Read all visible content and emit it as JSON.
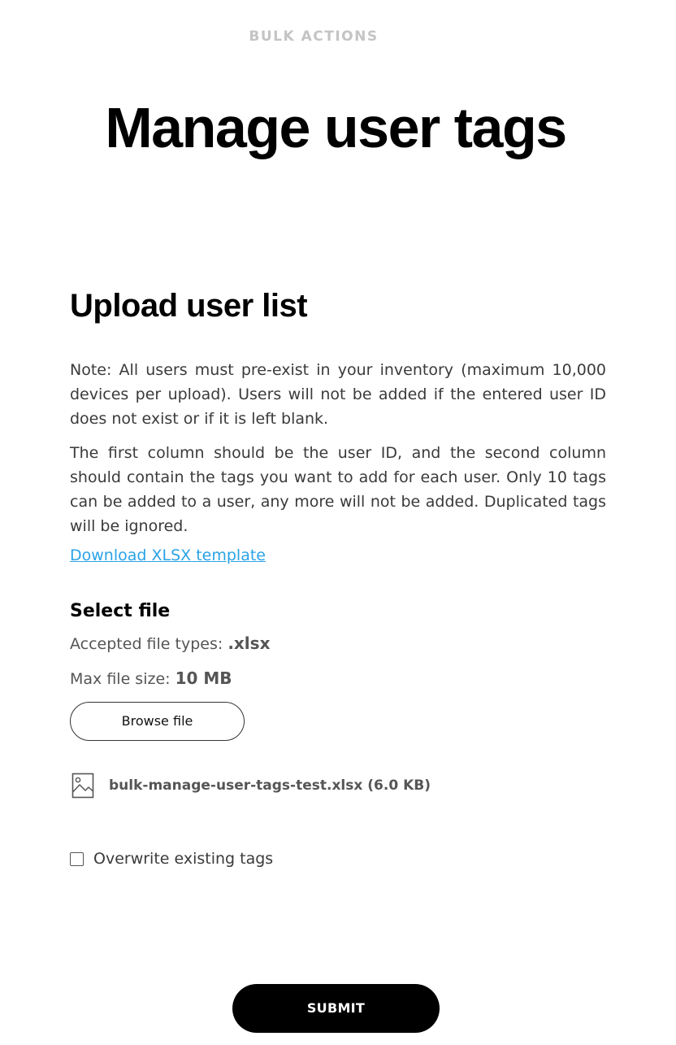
{
  "header": {
    "eyebrow": "BULK ACTIONS",
    "title": "Manage user tags"
  },
  "upload": {
    "section_title": "Upload user list",
    "note_1": "Note: All users must pre-exist in your inventory (maximum 10,000 devices per upload). Users will not be added if the entered user ID does not exist or if it is left blank.",
    "note_2": "The first column should be the user ID, and the second column should contain the tags you want to add for each user. Only 10 tags can be added to a user, any more will not be added. Duplicated tags will be ignored.",
    "template_link": "Download XLSX template"
  },
  "select_file": {
    "title": "Select file",
    "types_label": "Accepted file types: ",
    "types_value": ".xlsx",
    "size_label": "Max file size: ",
    "size_value": "10 MB",
    "browse_label": "Browse file",
    "file_icon": "image-file-icon",
    "file_name": "bulk-manage-user-tags-test.xlsx (6.0 KB)"
  },
  "options": {
    "overwrite_label": "Overwrite existing tags",
    "overwrite_checked": false
  },
  "actions": {
    "submit_label": "SUBMIT"
  },
  "colors": {
    "link": "#2aa3e6",
    "primary": "#000000",
    "eyebrow": "#c4c4c4"
  }
}
